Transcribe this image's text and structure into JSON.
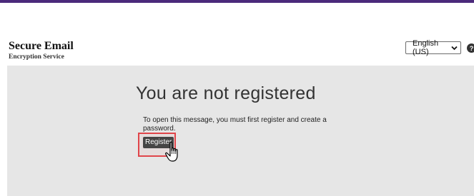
{
  "brand": {
    "title": "Secure Email",
    "subtitle": "Encryption Service"
  },
  "language": {
    "selected": "English (US)"
  },
  "main": {
    "heading": "You are not registered",
    "message": "To open this message, you must first register and create a password.",
    "register_label": "Register"
  },
  "icons": {
    "language_dropdown": "chevron-down-icon",
    "help": "help-icon",
    "cursor": "hand-pointer-cursor-icon"
  },
  "colors": {
    "top_bar": "#4b2a7b",
    "content_background": "#e6e6e6",
    "button_background": "#454545",
    "highlight_border": "#e0454a"
  }
}
